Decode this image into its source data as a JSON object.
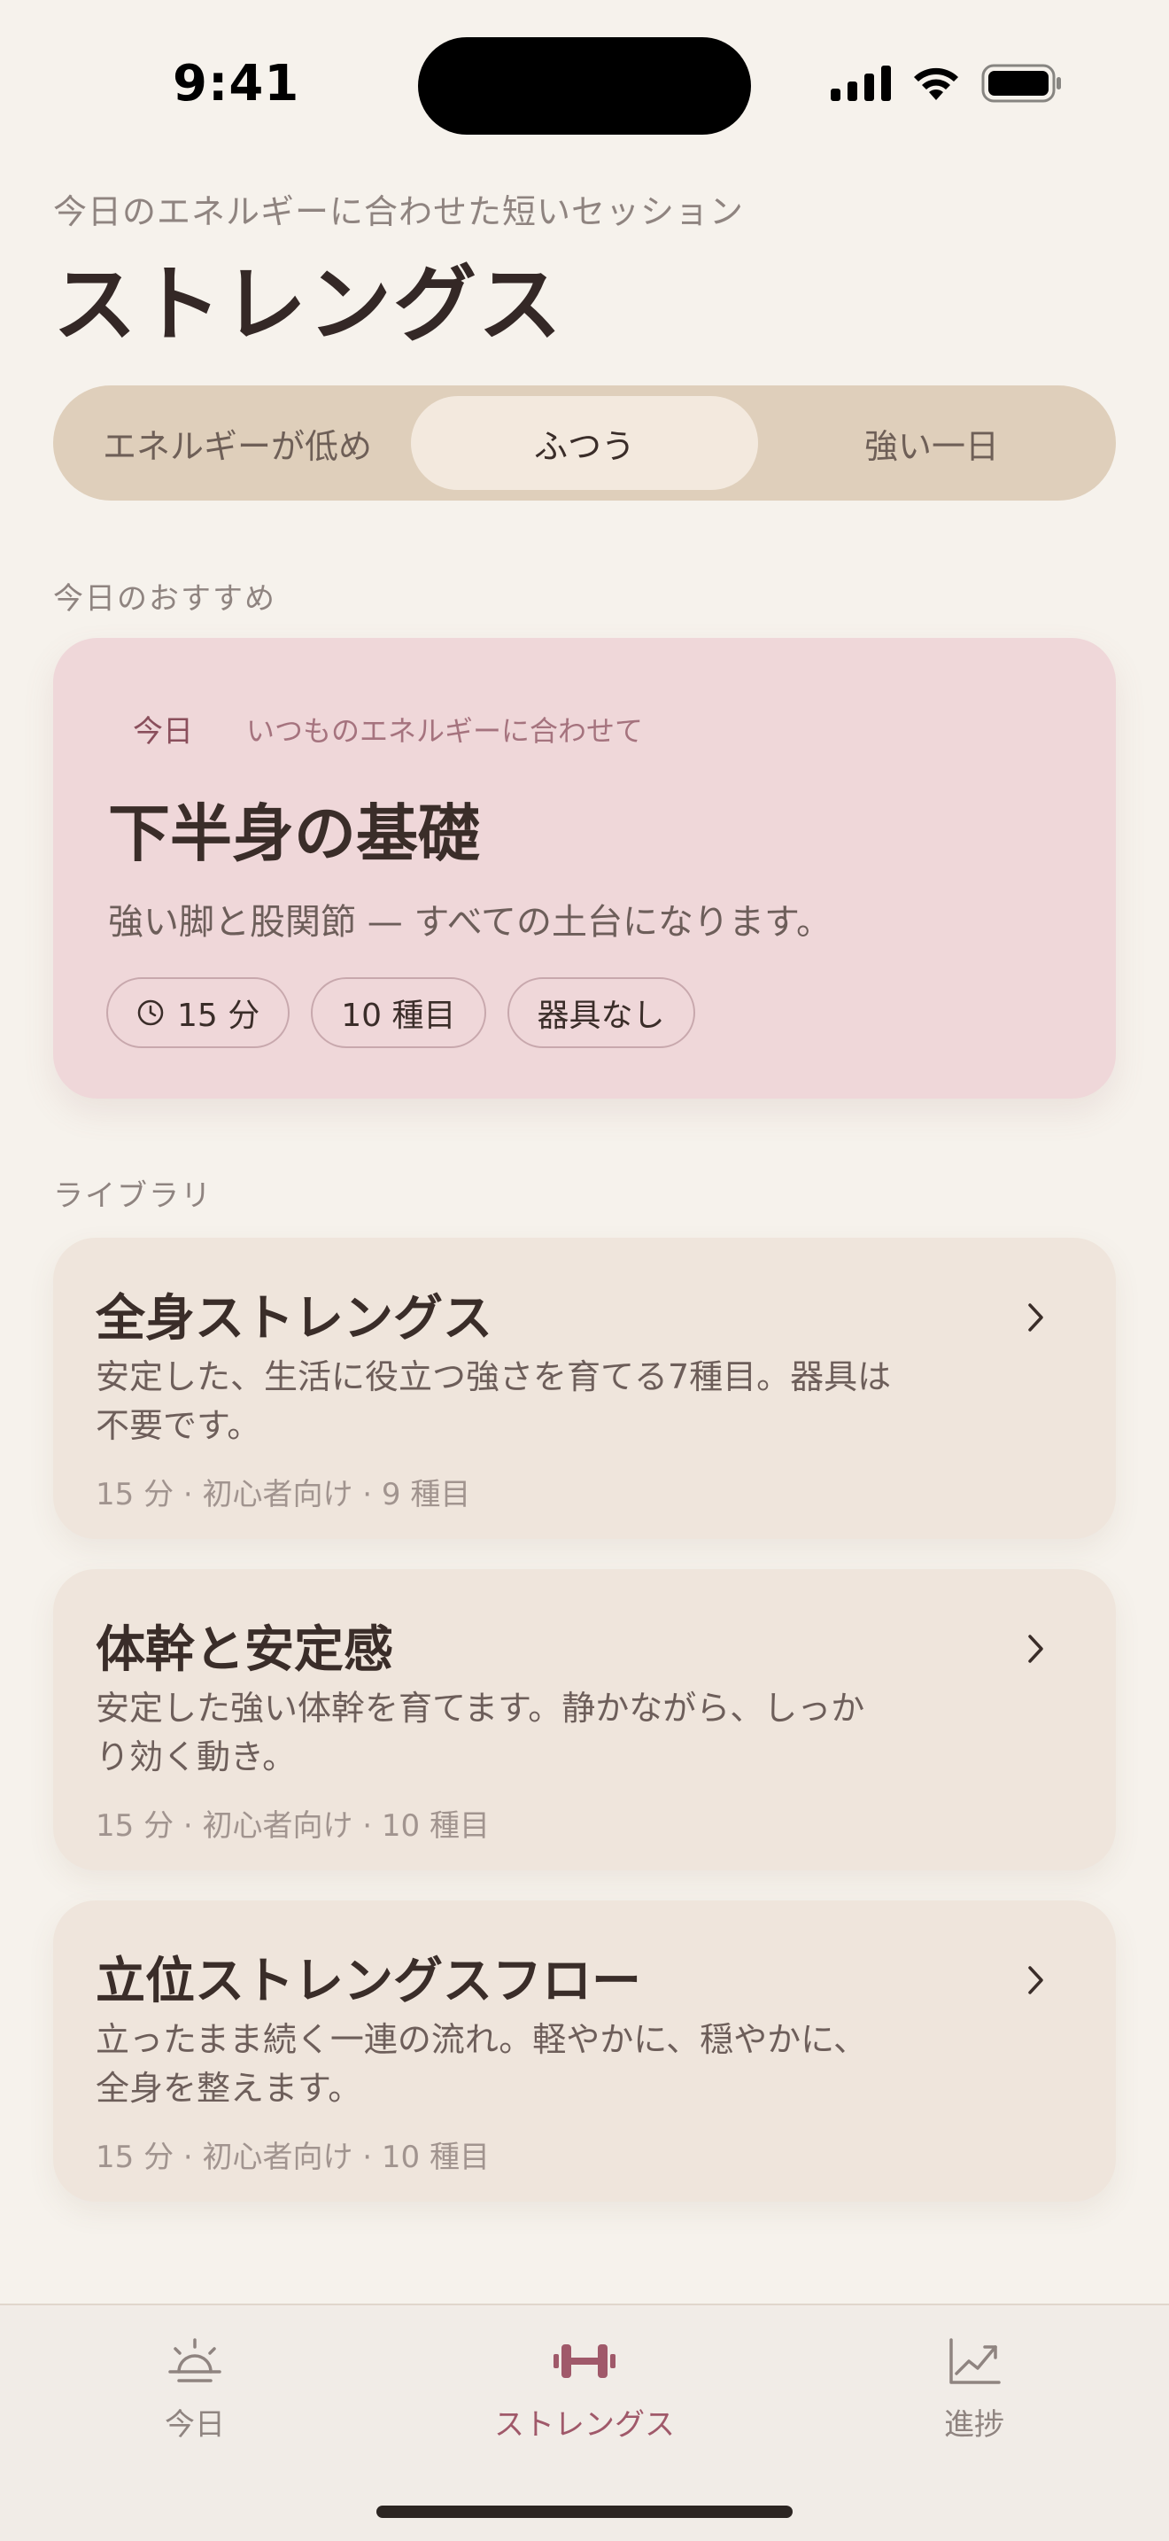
{
  "status_bar": {
    "time": "9:41"
  },
  "header": {
    "subtitle": "今日のエネルギーに合わせた短いセッション",
    "title": "ストレングス"
  },
  "energy_selector": {
    "options": [
      "エネルギーが低め",
      "ふつう",
      "強い一日"
    ],
    "selected": "ふつう"
  },
  "recommendation": {
    "section_label": "今日のおすすめ",
    "tag": "今日",
    "tag_sub": "いつものエネルギーに合わせて",
    "title": "下半身の基礎",
    "description": "強い脚と股関節 — すべての土台になります。",
    "chips": {
      "duration": "15 分",
      "count": "10 種目",
      "equipment": "器具なし"
    }
  },
  "library": {
    "section_label": "ライブラリ",
    "items": [
      {
        "title": "全身ストレングス",
        "description": "安定した、生活に役立つ強さを育てる7種目。器具は不要です。",
        "meta": "15 分 · 初心者向け · 9 種目"
      },
      {
        "title": "体幹と安定感",
        "description": "安定した強い体幹を育てます。静かながら、しっかり効く動き。",
        "meta": "15 分 · 初心者向け · 10 種目"
      },
      {
        "title": "立位ストレングスフロー",
        "description": "立ったまま続く一連の流れ。軽やかに、穏やかに、全身を整えます。",
        "meta": "15 分 · 初心者向け · 10 種目"
      }
    ]
  },
  "tab_bar": {
    "tabs": [
      {
        "label": "今日",
        "icon": "sunrise-icon"
      },
      {
        "label": "ストレングス",
        "icon": "dumbbell-icon"
      },
      {
        "label": "進捗",
        "icon": "chart-line-icon"
      }
    ],
    "active": "ストレングス"
  },
  "colors": {
    "background": "#f6f2ec",
    "accent": "#a0596a",
    "recommendation_card": "#efd7d9",
    "library_card": "#efe5dc",
    "segmented_track": "#dfcfbb"
  }
}
